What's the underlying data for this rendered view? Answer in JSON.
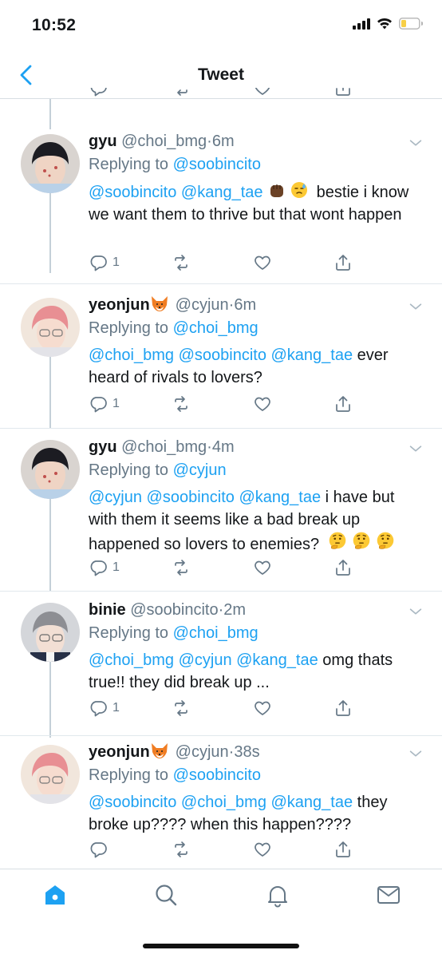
{
  "status_bar": {
    "time": "10:52"
  },
  "nav": {
    "title": "Tweet"
  },
  "colors": {
    "accent": "#1da1f2",
    "muted": "#657786",
    "text": "#14171a"
  },
  "tweets": [
    {
      "name": "gyu",
      "handle": "@choi_bmg",
      "time": "6m",
      "replying_prefix": "Replying to",
      "replying_to": "@soobincito",
      "mentions": "@soobincito @kang_tae",
      "text_tail": "bestie i know we want them to thrive but that wont happen",
      "reply_count": "1",
      "avatar": "avatar-boy-dark-hair"
    },
    {
      "name": "yeonjun",
      "handle": "@cyjun",
      "time": "6m",
      "replying_prefix": "Replying to",
      "replying_to": "@choi_bmg",
      "mentions": "@choi_bmg @soobincito @kang_tae",
      "text_tail": "ever heard of rivals to lovers?",
      "reply_count": "1",
      "avatar": "avatar-pink-hair"
    },
    {
      "name": "gyu",
      "handle": "@choi_bmg",
      "time": "4m",
      "replying_prefix": "Replying to",
      "replying_to": "@cyjun",
      "mentions": "@cyjun @soobincito @kang_tae",
      "text_tail": "i have but with them it seems like a bad break up happened so lovers to enemies?",
      "reply_count": "1",
      "avatar": "avatar-boy-dark-hair"
    },
    {
      "name": "binie",
      "handle": "@soobincito",
      "time": "2m",
      "replying_prefix": "Replying to",
      "replying_to": "@choi_bmg",
      "mentions": "@choi_bmg @cyjun @kang_tae",
      "text_tail": "omg thats true!! they did break up ...",
      "reply_count": "1",
      "avatar": "avatar-grey-hair"
    },
    {
      "name": "yeonjun",
      "handle": "@cyjun",
      "time": "38s",
      "replying_prefix": "Replying to",
      "replying_to": "@soobincito",
      "mentions": "@soobincito @choi_bmg @kang_tae",
      "text_tail": "they broke up???? when this happen????",
      "reply_count": "",
      "avatar": "avatar-pink-hair"
    }
  ],
  "tab_bar": {
    "tabs": [
      "home",
      "search",
      "notifications",
      "messages"
    ],
    "active": "home"
  }
}
